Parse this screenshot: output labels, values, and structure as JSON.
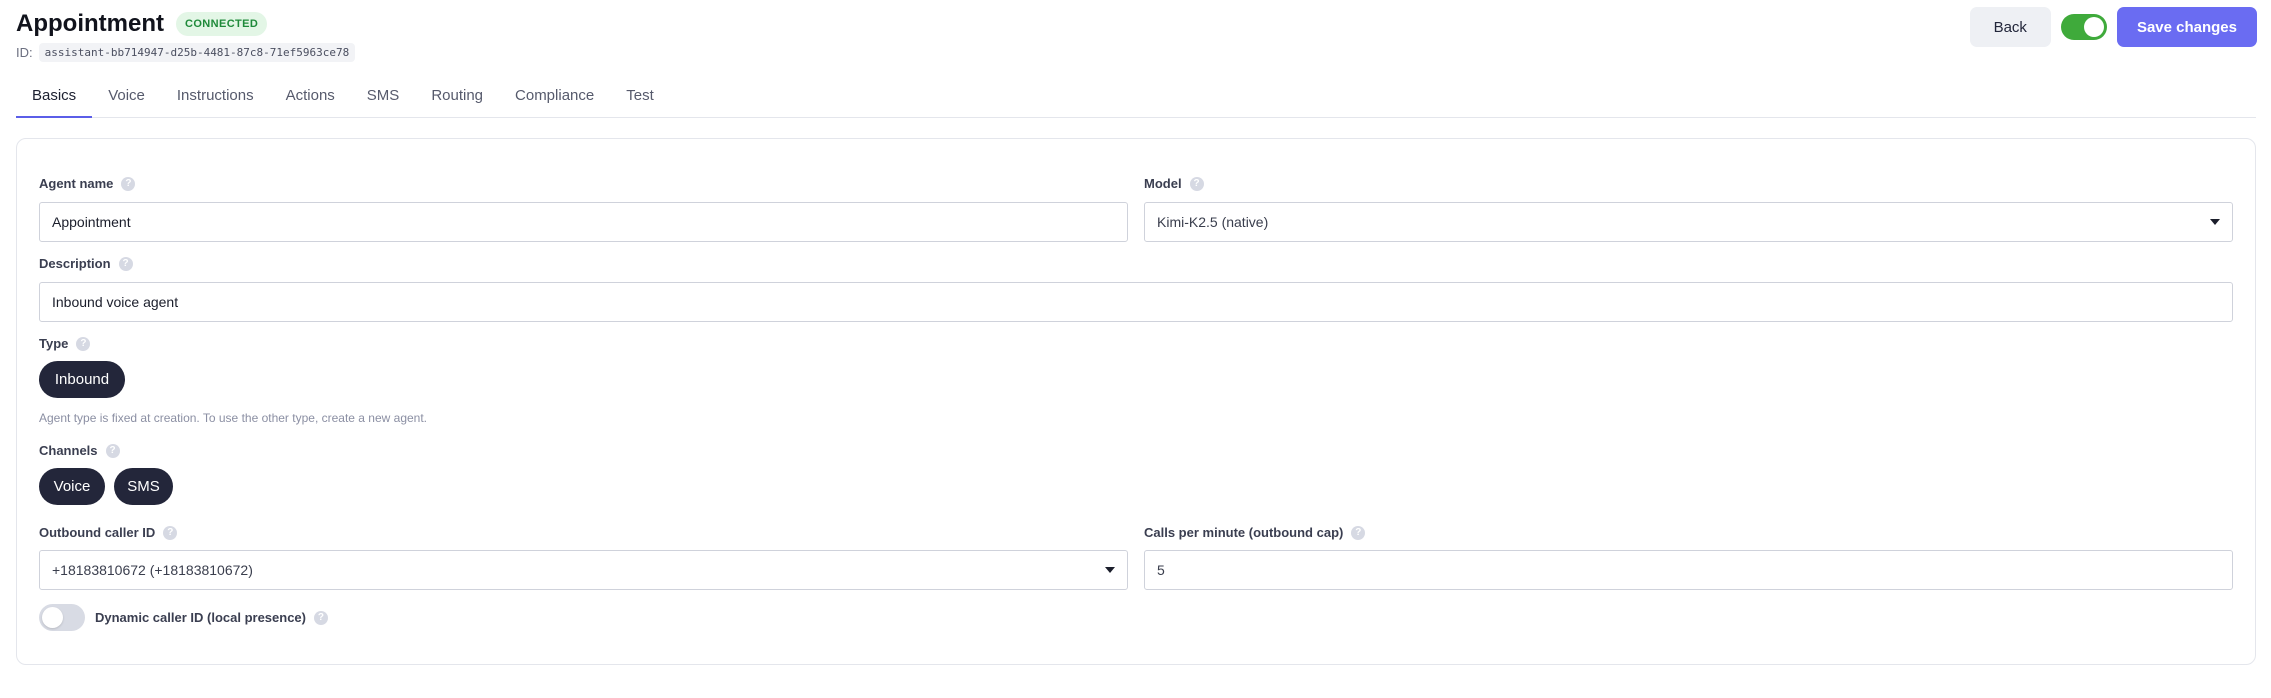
{
  "header": {
    "title": "Appointment",
    "status_badge": "CONNECTED",
    "id_label": "ID:",
    "id_value": "assistant-bb714947-d25b-4481-87c8-71ef5963ce78"
  },
  "actions": {
    "back_label": "Back",
    "enabled_toggle": true,
    "save_label": "Save changes"
  },
  "tabs": [
    {
      "label": "Basics",
      "active": true
    },
    {
      "label": "Voice"
    },
    {
      "label": "Instructions"
    },
    {
      "label": "Actions"
    },
    {
      "label": "SMS"
    },
    {
      "label": "Routing"
    },
    {
      "label": "Compliance"
    },
    {
      "label": "Test"
    }
  ],
  "form": {
    "agent_name": {
      "label": "Agent name",
      "value": "Appointment"
    },
    "model": {
      "label": "Model",
      "value": "Kimi-K2.5 (native)"
    },
    "description": {
      "label": "Description",
      "value": "Inbound voice agent"
    },
    "type": {
      "label": "Type",
      "value": "Inbound",
      "hint": "Agent type is fixed at creation. To use the other type, create a new agent."
    },
    "channels": {
      "label": "Channels",
      "options": [
        "Voice",
        "SMS"
      ]
    },
    "outbound_caller_id": {
      "label": "Outbound caller ID",
      "value": "+18183810672 (+18183810672)"
    },
    "calls_per_minute": {
      "label": "Calls per minute (outbound cap)",
      "value": "5"
    },
    "dynamic_caller_id": {
      "label": "Dynamic caller ID (local presence)",
      "enabled": false
    }
  },
  "help_glyph": "?",
  "colors": {
    "accent": "#6a6cf2",
    "tab_underline": "#5b5ee8",
    "pill_bg": "#23263a",
    "toggle_on": "#3faa3b",
    "badge_bg": "#e3f6e6",
    "badge_text": "#1f8a3a"
  }
}
